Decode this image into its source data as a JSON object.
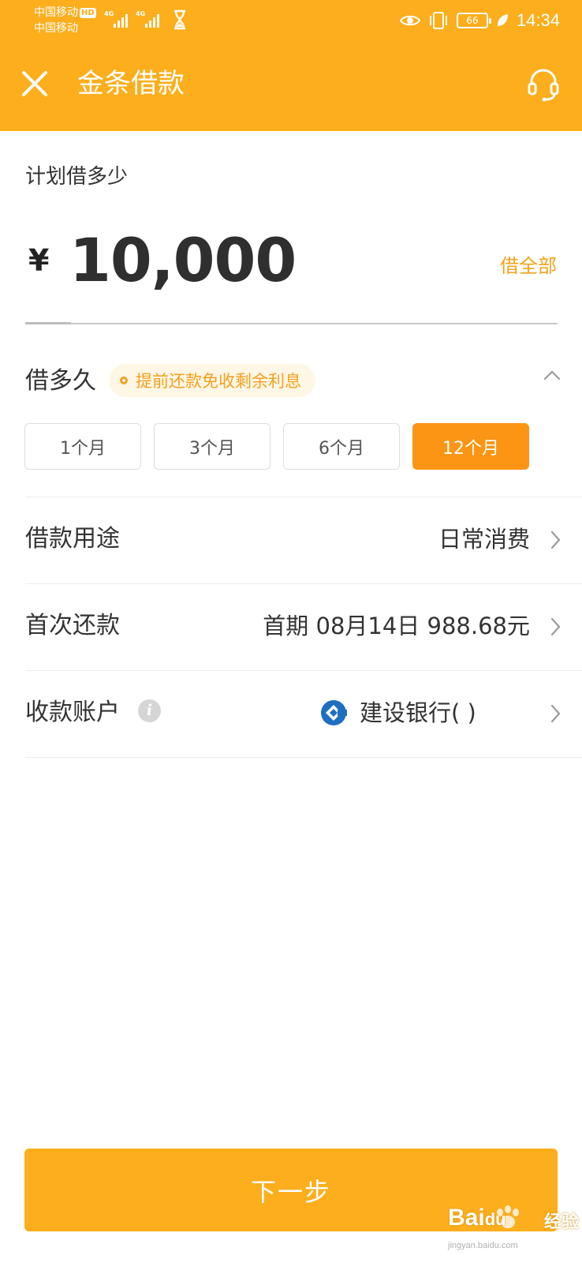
{
  "status_bar": {
    "carrier_1": "中国移动",
    "hd_badge": "HD",
    "carrier_2": "中国移动",
    "network_1": "4G",
    "network_2": "4G",
    "battery": "66",
    "time": "14:34"
  },
  "header": {
    "title": "金条借款",
    "close_icon": "close-icon",
    "service_icon": "headset-icon",
    "background_color": "#fcae1c"
  },
  "amount_section": {
    "label": "计划借多少",
    "currency_symbol": "¥",
    "amount": "10,000",
    "borrow_all_label": "借全部"
  },
  "term_section": {
    "label": "借多久",
    "promo_text": "提前还款免收剩余利息",
    "options": [
      "1个月",
      "3个月",
      "6个月",
      "12个月"
    ],
    "selected": "12个月"
  },
  "rows": {
    "purpose": {
      "label": "借款用途",
      "value": "日常消费"
    },
    "first_repayment": {
      "label": "首次还款",
      "value": "首期 08月14日 988.68元"
    },
    "account": {
      "label": "收款账户",
      "info_icon": "info-icon",
      "bank_icon": "ccb-bank-icon",
      "value": "建设银行(        )"
    }
  },
  "next_button": {
    "label": "下一步"
  },
  "watermark": {
    "brand": "Bai",
    "brand_suffix": "du",
    "sub": "经验",
    "url": "jingyan.baidu.com"
  },
  "colors": {
    "accent": "#fcae1c",
    "selected_term": "#fb9513",
    "promo_text": "#f4a01e"
  }
}
